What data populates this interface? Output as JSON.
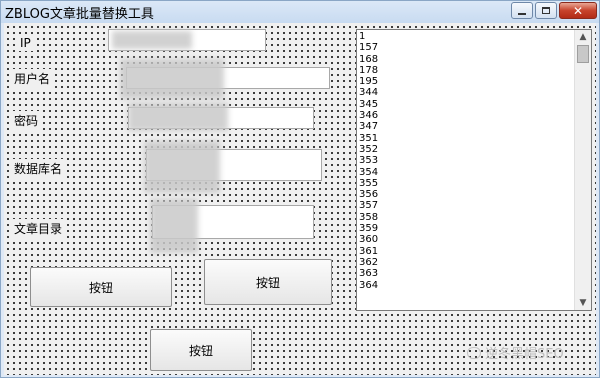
{
  "window": {
    "title": "ZBLOG文章批量替换工具",
    "close_glyph": "✕"
  },
  "form": {
    "ip_label": "IP",
    "username_label": "用户名",
    "password_label": "密码",
    "database_label": "数据库名",
    "article_dir_label": "文章目录",
    "ip_value": "",
    "username_value": "",
    "password_value": "",
    "database_value": "",
    "article_dir_value": ""
  },
  "buttons": {
    "button1": "按钮",
    "button2": "按钮",
    "button3": "按钮"
  },
  "list": {
    "items": [
      "1",
      "157",
      "168",
      "178",
      "195",
      "344",
      "345",
      "346",
      "347",
      "351",
      "352",
      "353",
      "354",
      "355",
      "356",
      "357",
      "358",
      "359",
      "360",
      "361",
      "362",
      "363",
      "364"
    ]
  },
  "scrollbar": {
    "up_glyph": "▲",
    "down_glyph": "▼"
  },
  "watermark": {
    "text": "逆冬黑帽SEO"
  }
}
